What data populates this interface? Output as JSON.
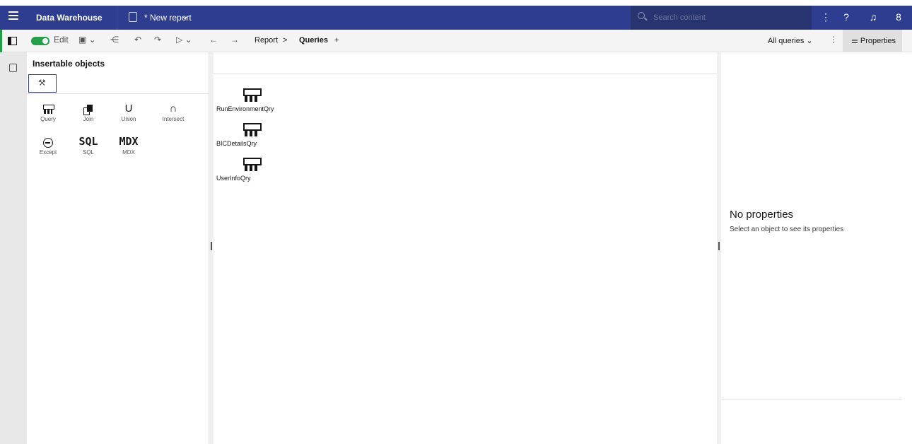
{
  "topbar": {
    "menu_icon": "hamburger-icon",
    "app_title": "Data Warehouse",
    "report_icon": "clipboard-icon",
    "report_title": "* New report",
    "report_chevron": "chevron-down-icon",
    "search": {
      "placeholder": "Search content",
      "icon": "search-icon"
    },
    "icons": [
      "overflow-menu-icon",
      "help-icon",
      "notification-icon",
      "user-icon"
    ],
    "colors": {
      "bar": "#2e3d8f",
      "search_bg": "#27346f"
    }
  },
  "toolbar": {
    "edit_label": "Edit",
    "edit_toggle_on": true,
    "tools": [
      "save-icon",
      "share-icon",
      "undo-icon",
      "redo-icon",
      "run-icon",
      "back-icon",
      "forward-icon"
    ],
    "breadcrumb": {
      "parent": "Report",
      "separator": ">",
      "current": "Queries",
      "add": "+"
    },
    "filter_label": "All queries",
    "properties_label": "Properties",
    "colors": {
      "toggle": "#24a148"
    }
  },
  "insertable": {
    "title": "Insertable objects",
    "tab_icon": "wrench-icon",
    "objects": [
      {
        "label": "Query",
        "icon": "query-icon"
      },
      {
        "label": "Join",
        "icon": "join-icon"
      },
      {
        "label": "Union",
        "icon": "union-icon",
        "glyph": "U"
      },
      {
        "label": "Intersect",
        "icon": "intersect-icon",
        "glyph": "∩"
      },
      {
        "label": "Except",
        "icon": "except-icon"
      },
      {
        "label": "SQL",
        "icon": "sql-icon",
        "glyph": "SQL"
      },
      {
        "label": "MDX",
        "icon": "mdx-icon",
        "glyph": "MDX"
      }
    ]
  },
  "canvas": {
    "queries": [
      {
        "name": "RunEnvironmentQry"
      },
      {
        "name": "BICDetailsQry"
      },
      {
        "name": "UserInfoQry"
      }
    ]
  },
  "properties": {
    "empty_title": "No properties",
    "empty_hint": "Select an object to see its properties"
  }
}
